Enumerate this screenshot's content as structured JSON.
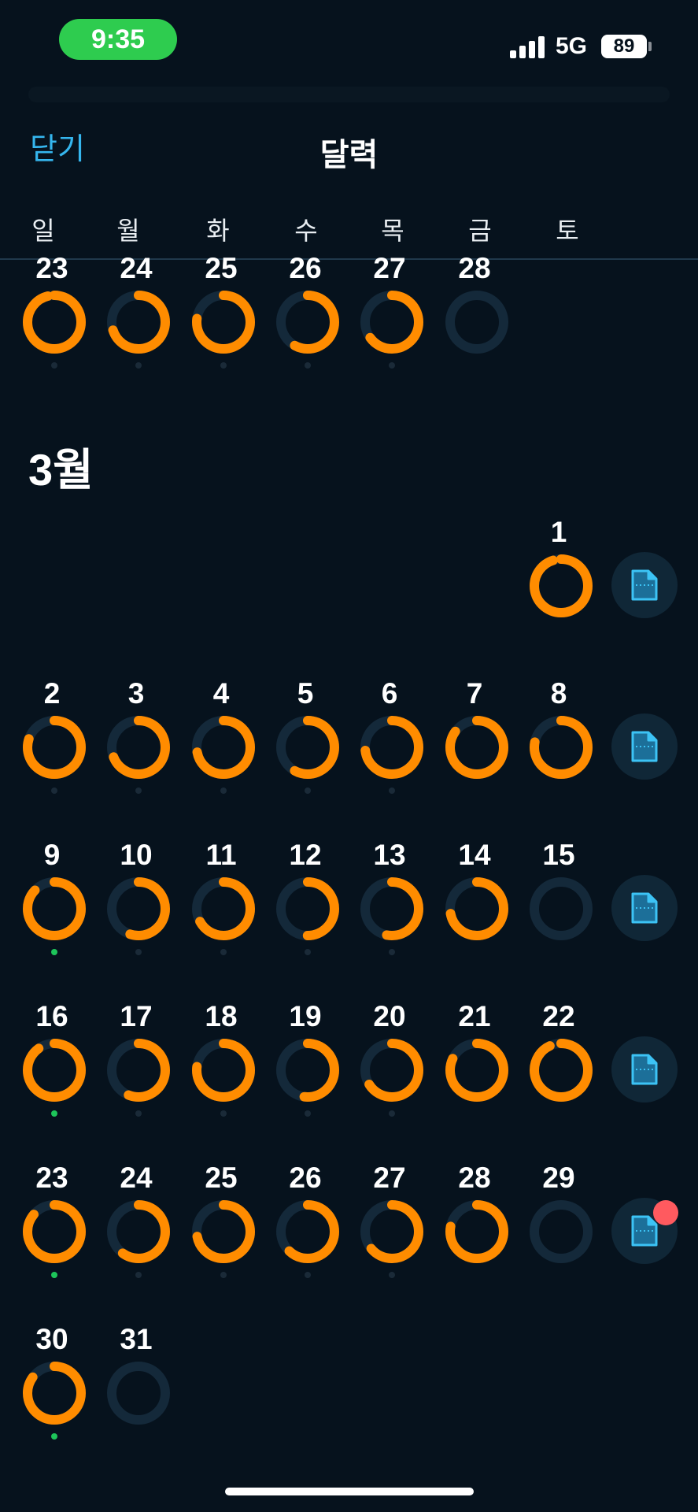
{
  "status": {
    "time": "9:35",
    "network": "5G",
    "battery": "89"
  },
  "header": {
    "close_label": "닫기",
    "title": "달력"
  },
  "weekdays": [
    "일",
    "월",
    "화",
    "수",
    "목",
    "금",
    "토"
  ],
  "month_label": "3월",
  "colors": {
    "accent": "#ff8c00",
    "track": "#14293a",
    "link": "#35b6ee",
    "green_dot": "#1dc55a",
    "badge": "#ff5a5f"
  },
  "weeks": [
    {
      "days": [
        {
          "n": "23",
          "col": 0,
          "p": 0.96,
          "dot": "dark"
        },
        {
          "n": "24",
          "col": 1,
          "p": 0.7,
          "dot": "dark"
        },
        {
          "n": "25",
          "col": 2,
          "p": 0.77,
          "dot": "dark"
        },
        {
          "n": "26",
          "col": 3,
          "p": 0.58,
          "dot": "dark"
        },
        {
          "n": "27",
          "col": 4,
          "p": 0.65,
          "dot": "dark"
        },
        {
          "n": "28",
          "col": 5,
          "p": 0,
          "dot": "none"
        }
      ],
      "note": false
    },
    {
      "days": [
        {
          "n": "1",
          "col": 6,
          "p": 0.95,
          "dot": "none"
        }
      ],
      "note": true
    },
    {
      "days": [
        {
          "n": "2",
          "col": 0,
          "p": 0.8,
          "dot": "dark"
        },
        {
          "n": "3",
          "col": 1,
          "p": 0.69,
          "dot": "dark"
        },
        {
          "n": "4",
          "col": 2,
          "p": 0.72,
          "dot": "dark"
        },
        {
          "n": "5",
          "col": 3,
          "p": 0.58,
          "dot": "dark"
        },
        {
          "n": "6",
          "col": 4,
          "p": 0.73,
          "dot": "dark"
        },
        {
          "n": "7",
          "col": 5,
          "p": 0.85,
          "dot": "none"
        },
        {
          "n": "8",
          "col": 6,
          "p": 0.78,
          "dot": "none"
        }
      ],
      "note": true
    },
    {
      "days": [
        {
          "n": "9",
          "col": 0,
          "p": 0.87,
          "dot": "green"
        },
        {
          "n": "10",
          "col": 1,
          "p": 0.55,
          "dot": "dark"
        },
        {
          "n": "11",
          "col": 2,
          "p": 0.67,
          "dot": "dark"
        },
        {
          "n": "12",
          "col": 3,
          "p": 0.5,
          "dot": "dark"
        },
        {
          "n": "13",
          "col": 4,
          "p": 0.53,
          "dot": "dark"
        },
        {
          "n": "14",
          "col": 5,
          "p": 0.72,
          "dot": "none"
        },
        {
          "n": "15",
          "col": 6,
          "p": 0,
          "dot": "none"
        }
      ],
      "note": true
    },
    {
      "days": [
        {
          "n": "16",
          "col": 0,
          "p": 0.9,
          "dot": "green"
        },
        {
          "n": "17",
          "col": 1,
          "p": 0.56,
          "dot": "dark"
        },
        {
          "n": "18",
          "col": 2,
          "p": 0.77,
          "dot": "dark"
        },
        {
          "n": "19",
          "col": 3,
          "p": 0.52,
          "dot": "dark"
        },
        {
          "n": "20",
          "col": 4,
          "p": 0.66,
          "dot": "dark"
        },
        {
          "n": "21",
          "col": 5,
          "p": 0.82,
          "dot": "none"
        },
        {
          "n": "22",
          "col": 6,
          "p": 0.93,
          "dot": "none"
        }
      ],
      "note": true
    },
    {
      "days": [
        {
          "n": "23",
          "col": 0,
          "p": 0.86,
          "dot": "green"
        },
        {
          "n": "24",
          "col": 1,
          "p": 0.6,
          "dot": "dark"
        },
        {
          "n": "25",
          "col": 2,
          "p": 0.72,
          "dot": "dark"
        },
        {
          "n": "26",
          "col": 3,
          "p": 0.62,
          "dot": "dark"
        },
        {
          "n": "27",
          "col": 4,
          "p": 0.64,
          "dot": "dark"
        },
        {
          "n": "28",
          "col": 5,
          "p": 0.78,
          "dot": "none"
        },
        {
          "n": "29",
          "col": 6,
          "p": 0,
          "dot": "none"
        }
      ],
      "note": true,
      "badge": true
    },
    {
      "days": [
        {
          "n": "30",
          "col": 0,
          "p": 0.85,
          "dot": "green"
        },
        {
          "n": "31",
          "col": 1,
          "p": 0,
          "dot": "none"
        }
      ],
      "note": false
    }
  ]
}
